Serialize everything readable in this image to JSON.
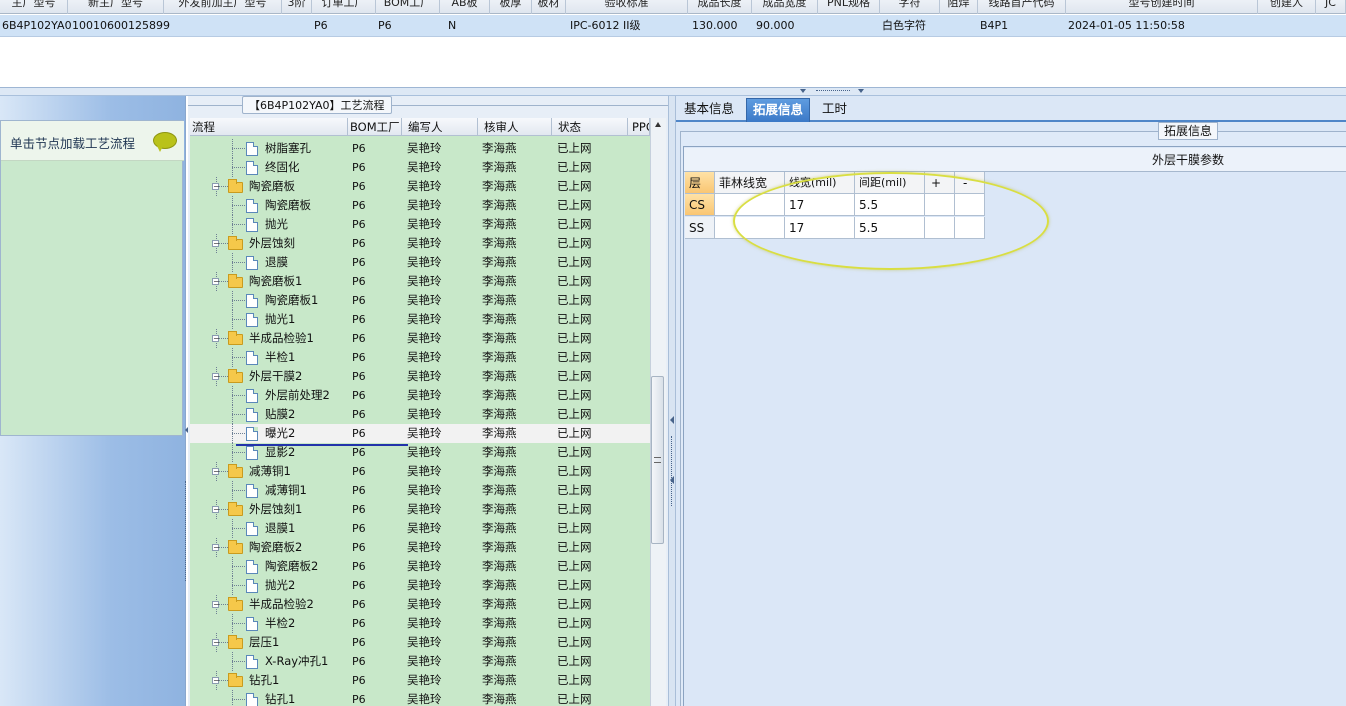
{
  "top_grid": {
    "headers": [
      "主厂型号",
      "新主厂型号",
      "外发前加主厂型号",
      "3阶",
      "订单工厂",
      "BOM工厂",
      "AB板",
      "板厚",
      "板材",
      "验收标准",
      "成品长度",
      "成品宽度",
      "PNL规格",
      "字符",
      "阻焊",
      "线路首产代码",
      "型号创建时间",
      "创建人",
      "JC"
    ],
    "row": {
      "code": "6B4P102YA0",
      "number": "10010600125899",
      "order_factory": "P6",
      "bom_factory": "P6",
      "ab": "N",
      "standard": "IPC-6012 II级",
      "length": "130.000",
      "width": "90.000",
      "char": "白色字符",
      "line_code": "B4P1",
      "created": "2024-01-05 11:50:58"
    }
  },
  "left_panel": {
    "hint": "单击节点加载工艺流程"
  },
  "tree_panel": {
    "title": "【6B4P102YA0】工艺流程",
    "columns": [
      "流程",
      "BOM工厂",
      "编写人",
      "核审人",
      "状态",
      "PPC"
    ],
    "rows": [
      {
        "name": "树脂塞孔",
        "level": 2,
        "type": "doc",
        "factory": "P6",
        "writer": "吴艳玲",
        "reviewer": "李海燕",
        "status": "已上网"
      },
      {
        "name": "终固化",
        "level": 2,
        "type": "doc",
        "factory": "P6",
        "writer": "吴艳玲",
        "reviewer": "李海燕",
        "status": "已上网"
      },
      {
        "name": "陶瓷磨板",
        "level": 1,
        "type": "folder",
        "factory": "P6",
        "writer": "吴艳玲",
        "reviewer": "李海燕",
        "status": "已上网"
      },
      {
        "name": "陶瓷磨板",
        "level": 2,
        "type": "doc",
        "factory": "P6",
        "writer": "吴艳玲",
        "reviewer": "李海燕",
        "status": "已上网"
      },
      {
        "name": "抛光",
        "level": 2,
        "type": "doc",
        "factory": "P6",
        "writer": "吴艳玲",
        "reviewer": "李海燕",
        "status": "已上网"
      },
      {
        "name": "外层蚀刻",
        "level": 1,
        "type": "folder",
        "factory": "P6",
        "writer": "吴艳玲",
        "reviewer": "李海燕",
        "status": "已上网"
      },
      {
        "name": "退膜",
        "level": 2,
        "type": "doc",
        "factory": "P6",
        "writer": "吴艳玲",
        "reviewer": "李海燕",
        "status": "已上网"
      },
      {
        "name": "陶瓷磨板1",
        "level": 1,
        "type": "folder",
        "factory": "P6",
        "writer": "吴艳玲",
        "reviewer": "李海燕",
        "status": "已上网"
      },
      {
        "name": "陶瓷磨板1",
        "level": 2,
        "type": "doc",
        "factory": "P6",
        "writer": "吴艳玲",
        "reviewer": "李海燕",
        "status": "已上网"
      },
      {
        "name": "抛光1",
        "level": 2,
        "type": "doc",
        "factory": "P6",
        "writer": "吴艳玲",
        "reviewer": "李海燕",
        "status": "已上网"
      },
      {
        "name": "半成品检验1",
        "level": 1,
        "type": "folder",
        "factory": "P6",
        "writer": "吴艳玲",
        "reviewer": "李海燕",
        "status": "已上网"
      },
      {
        "name": "半检1",
        "level": 2,
        "type": "doc",
        "factory": "P6",
        "writer": "吴艳玲",
        "reviewer": "李海燕",
        "status": "已上网"
      },
      {
        "name": "外层干膜2",
        "level": 1,
        "type": "folder",
        "factory": "P6",
        "writer": "吴艳玲",
        "reviewer": "李海燕",
        "status": "已上网"
      },
      {
        "name": "外层前处理2",
        "level": 2,
        "type": "doc",
        "factory": "P6",
        "writer": "吴艳玲",
        "reviewer": "李海燕",
        "status": "已上网"
      },
      {
        "name": "贴膜2",
        "level": 2,
        "type": "doc",
        "factory": "P6",
        "writer": "吴艳玲",
        "reviewer": "李海燕",
        "status": "已上网"
      },
      {
        "name": "曝光2",
        "level": 2,
        "type": "doc",
        "factory": "P6",
        "writer": "吴艳玲",
        "reviewer": "李海燕",
        "status": "已上网",
        "selected": true
      },
      {
        "name": "显影2",
        "level": 2,
        "type": "doc",
        "factory": "P6",
        "writer": "吴艳玲",
        "reviewer": "李海燕",
        "status": "已上网"
      },
      {
        "name": "减薄铜1",
        "level": 1,
        "type": "folder",
        "factory": "P6",
        "writer": "吴艳玲",
        "reviewer": "李海燕",
        "status": "已上网"
      },
      {
        "name": "减薄铜1",
        "level": 2,
        "type": "doc",
        "factory": "P6",
        "writer": "吴艳玲",
        "reviewer": "李海燕",
        "status": "已上网"
      },
      {
        "name": "外层蚀刻1",
        "level": 1,
        "type": "folder",
        "factory": "P6",
        "writer": "吴艳玲",
        "reviewer": "李海燕",
        "status": "已上网"
      },
      {
        "name": "退膜1",
        "level": 2,
        "type": "doc",
        "factory": "P6",
        "writer": "吴艳玲",
        "reviewer": "李海燕",
        "status": "已上网"
      },
      {
        "name": "陶瓷磨板2",
        "level": 1,
        "type": "folder",
        "factory": "P6",
        "writer": "吴艳玲",
        "reviewer": "李海燕",
        "status": "已上网"
      },
      {
        "name": "陶瓷磨板2",
        "level": 2,
        "type": "doc",
        "factory": "P6",
        "writer": "吴艳玲",
        "reviewer": "李海燕",
        "status": "已上网"
      },
      {
        "name": "抛光2",
        "level": 2,
        "type": "doc",
        "factory": "P6",
        "writer": "吴艳玲",
        "reviewer": "李海燕",
        "status": "已上网"
      },
      {
        "name": "半成品检验2",
        "level": 1,
        "type": "folder",
        "factory": "P6",
        "writer": "吴艳玲",
        "reviewer": "李海燕",
        "status": "已上网"
      },
      {
        "name": "半检2",
        "level": 2,
        "type": "doc",
        "factory": "P6",
        "writer": "吴艳玲",
        "reviewer": "李海燕",
        "status": "已上网"
      },
      {
        "name": "层压1",
        "level": 1,
        "type": "folder",
        "factory": "P6",
        "writer": "吴艳玲",
        "reviewer": "李海燕",
        "status": "已上网"
      },
      {
        "name": "X-Ray冲孔1",
        "level": 2,
        "type": "doc",
        "factory": "P6",
        "writer": "吴艳玲",
        "reviewer": "李海燕",
        "status": "已上网"
      },
      {
        "name": "钻孔1",
        "level": 1,
        "type": "folder",
        "factory": "P6",
        "writer": "吴艳玲",
        "reviewer": "李海燕",
        "status": "已上网"
      },
      {
        "name": "钻孔1",
        "level": 2,
        "type": "doc",
        "factory": "P6",
        "writer": "吴艳玲",
        "reviewer": "李海燕",
        "status": "已上网"
      }
    ]
  },
  "right_panel": {
    "tabs": [
      "基本信息",
      "拓展信息",
      "工时"
    ],
    "active_tab": 1,
    "ext_group_label": "拓展信息",
    "film_title": "外层干膜参数",
    "grid_headers": [
      "层",
      "菲林线宽",
      "线宽(mil)",
      "间距(mil)",
      "+",
      "-"
    ],
    "grid_rows": [
      {
        "layer": "CS",
        "film_width": "",
        "width": "17",
        "spacing": "5.5"
      },
      {
        "layer": "SS",
        "film_width": "",
        "width": "17",
        "spacing": "5.5"
      }
    ]
  },
  "colors": {
    "tree_bg": "#c8e8c9",
    "selection_row": "#cfe2f6",
    "active_tab": "#3b79c7",
    "annotation_ellipse": "#d9de42",
    "annotation_underline": "#2233aa"
  }
}
